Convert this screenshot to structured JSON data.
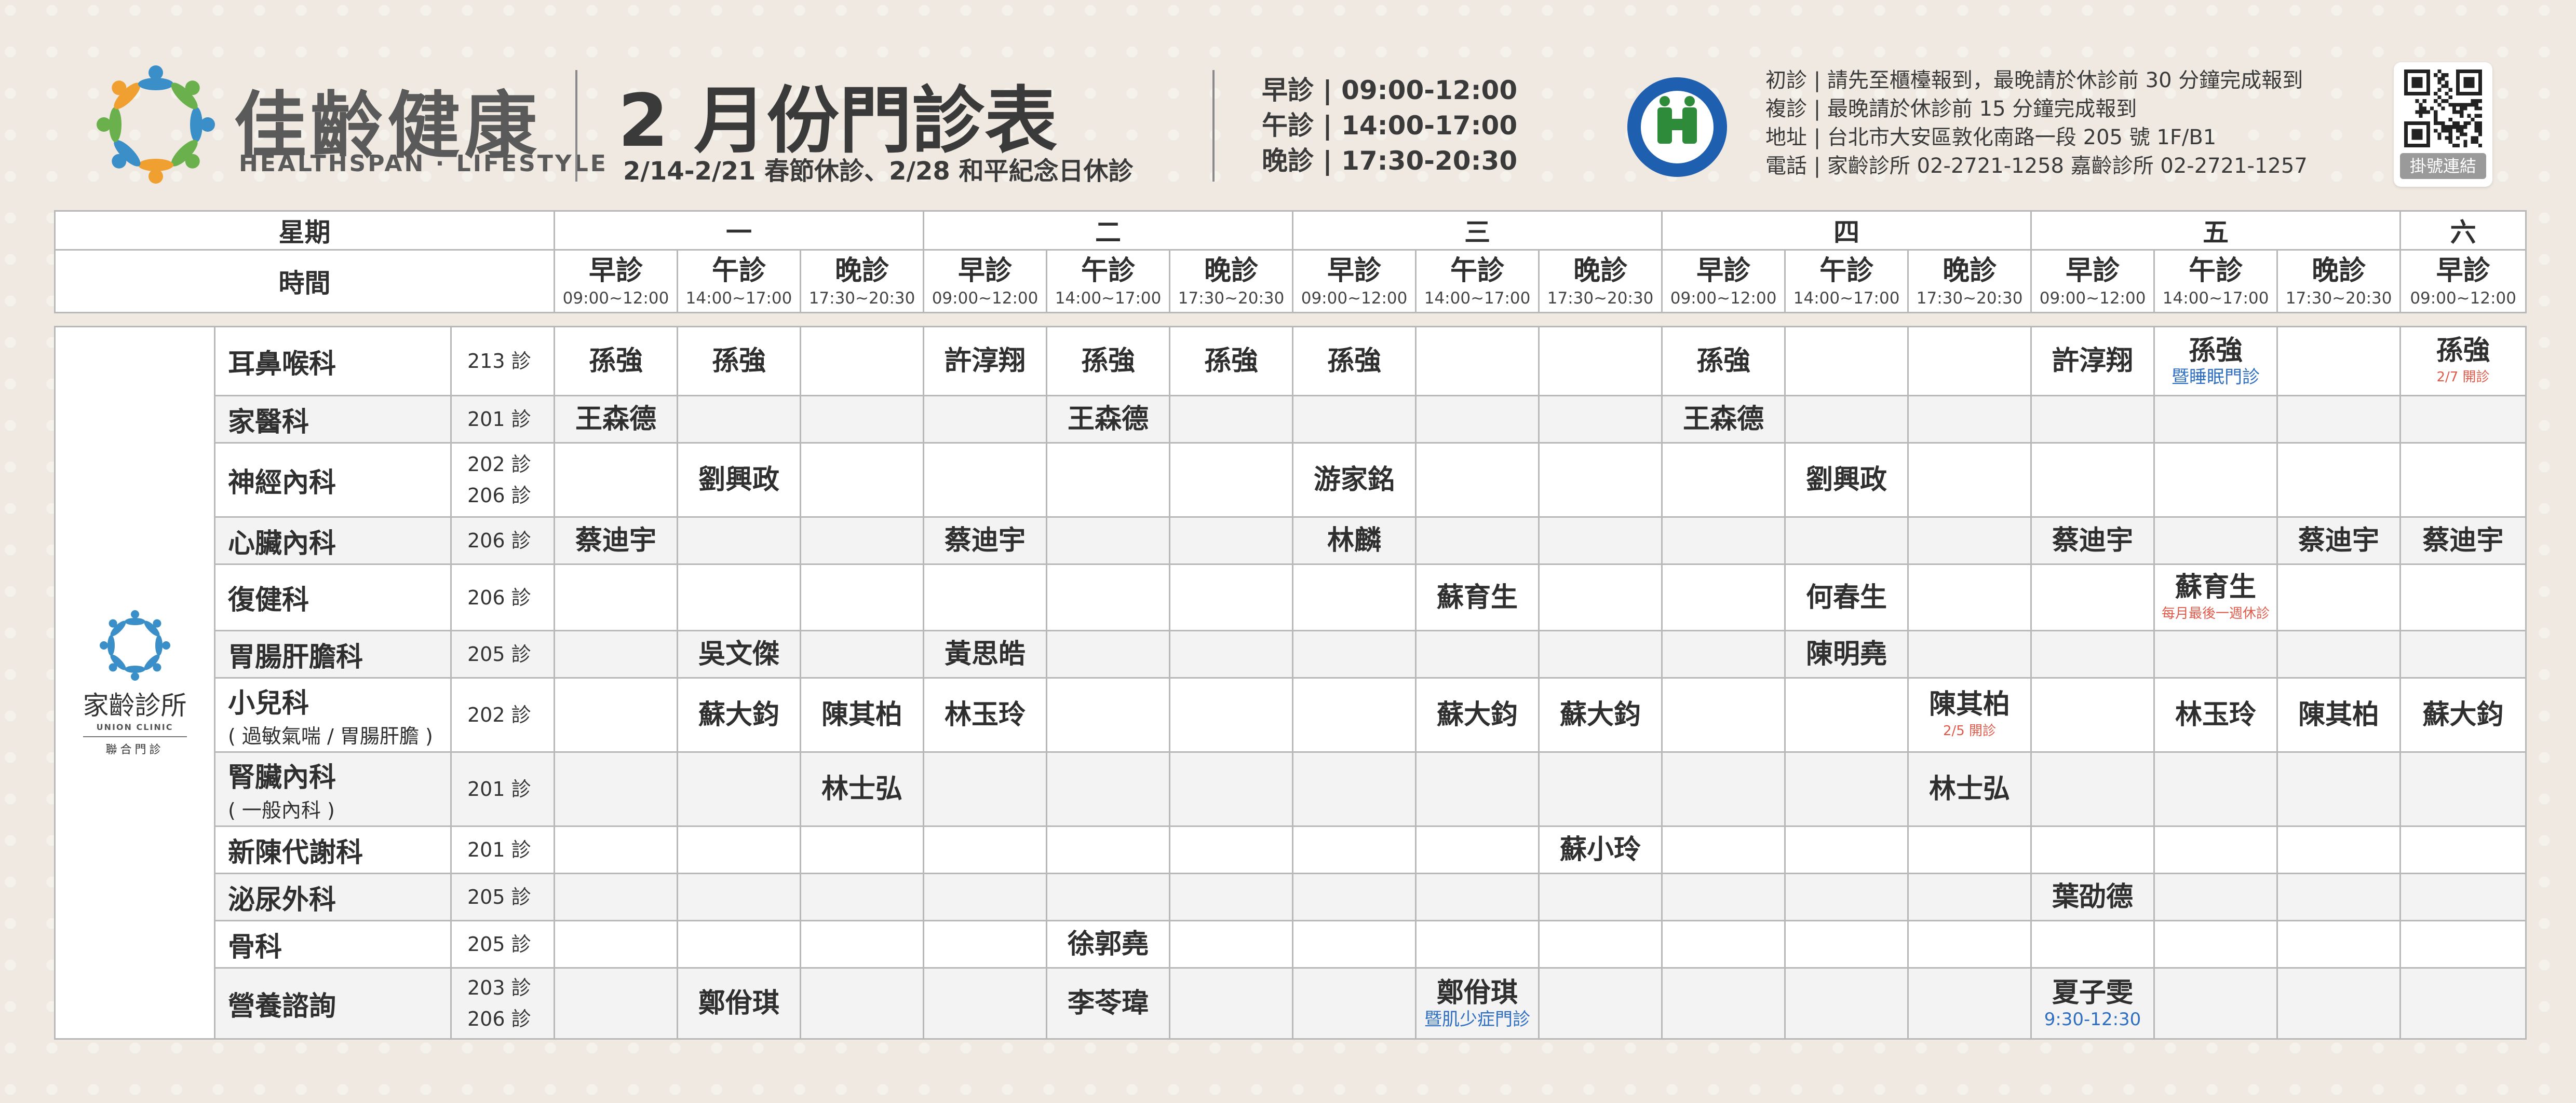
{
  "header": {
    "brand_name": "佳齡健康",
    "brand_sub": "HEALTHSPAN · LIFESTYLE",
    "title": "2 月份門診表",
    "subtitle": "2/14-2/21 春節休診、2/28 和平紀念日休診",
    "sessions": [
      {
        "label": "早診",
        "time": "09:00-12:00"
      },
      {
        "label": "午診",
        "time": "14:00-17:00"
      },
      {
        "label": "晚診",
        "time": "17:30-20:30"
      }
    ],
    "nhi_text": "全民健康保險 NATIONAL HEALTH INSURANCE",
    "notes": [
      {
        "label": "初診",
        "text": "請先至櫃檯報到，最晚請於休診前 30 分鐘完成報到"
      },
      {
        "label": "複診",
        "text": "最晚請於休診前 15 分鐘完成報到"
      },
      {
        "label": "地址",
        "text": "台北市大安區敦化南路一段 205 號 1F/B1"
      },
      {
        "label": "電話",
        "text": "家齡診所 02-2721-1258 嘉齡診所 02-2721-1257"
      }
    ],
    "qr_label": "掛號連結"
  },
  "table": {
    "weekday_label": "星期",
    "time_label": "時間",
    "days": [
      "一",
      "二",
      "三",
      "四",
      "五",
      "六"
    ],
    "session_names": [
      "早診",
      "午診",
      "晚診"
    ],
    "session_times": [
      "09:00~12:00",
      "14:00~17:00",
      "17:30~20:30"
    ],
    "clinic": {
      "name": "家齡診所",
      "en": "UNION CLINIC",
      "tag": "聯合門診"
    },
    "rows": [
      {
        "dept": "耳鼻喉科",
        "dept_sub": "",
        "room": "213 診",
        "cells": [
          {
            "doctor": "孫強"
          },
          {
            "doctor": "孫強"
          },
          {},
          {
            "doctor": "許淳翔"
          },
          {
            "doctor": "孫強"
          },
          {
            "doctor": "孫強"
          },
          {
            "doctor": "孫強"
          },
          {},
          {},
          {
            "doctor": "孫強"
          },
          {},
          {},
          {
            "doctor": "許淳翔"
          },
          {
            "doctor": "孫強",
            "note": "暨睡眠門診",
            "note_color": "blue"
          },
          {},
          {
            "doctor": "孫強",
            "note": "2/7 開診",
            "note_color": "red"
          }
        ]
      },
      {
        "dept": "家醫科",
        "dept_sub": "",
        "room": "201 診",
        "cells": [
          {
            "doctor": "王森德"
          },
          {},
          {},
          {},
          {
            "doctor": "王森德"
          },
          {},
          {},
          {},
          {},
          {
            "doctor": "王森德"
          },
          {},
          {},
          {},
          {},
          {},
          {}
        ]
      },
      {
        "dept": "神經內科",
        "dept_sub": "",
        "room": "202 診\n206 診",
        "cells": [
          {},
          {
            "doctor": "劉興政"
          },
          {},
          {},
          {},
          {},
          {
            "doctor": "游家銘"
          },
          {},
          {},
          {},
          {
            "doctor": "劉興政"
          },
          {},
          {},
          {},
          {},
          {}
        ]
      },
      {
        "dept": "心臟內科",
        "dept_sub": "",
        "room": "206 診",
        "cells": [
          {
            "doctor": "蔡迪宇"
          },
          {},
          {},
          {
            "doctor": "蔡迪宇"
          },
          {},
          {},
          {
            "doctor": "林麟"
          },
          {},
          {},
          {},
          {},
          {},
          {
            "doctor": "蔡迪宇"
          },
          {},
          {
            "doctor": "蔡迪宇"
          },
          {
            "doctor": "蔡迪宇"
          }
        ]
      },
      {
        "dept": "復健科",
        "dept_sub": "",
        "room": "206 診",
        "cells": [
          {},
          {},
          {},
          {},
          {},
          {},
          {},
          {
            "doctor": "蘇育生"
          },
          {},
          {},
          {
            "doctor": "何春生"
          },
          {},
          {},
          {
            "doctor": "蘇育生",
            "note": "每月最後一週休診",
            "note_color": "red"
          },
          {},
          {}
        ]
      },
      {
        "dept": "胃腸肝膽科",
        "dept_sub": "",
        "room": "205 診",
        "cells": [
          {},
          {
            "doctor": "吳文傑"
          },
          {},
          {
            "doctor": "黃思皓"
          },
          {},
          {},
          {},
          {},
          {},
          {},
          {
            "doctor": "陳明堯"
          },
          {},
          {},
          {},
          {},
          {}
        ]
      },
      {
        "dept": "小兒科",
        "dept_sub": "( 過敏氣喘 / 胃腸肝膽 )",
        "room": "202 診",
        "cells": [
          {},
          {
            "doctor": "蘇大鈞"
          },
          {
            "doctor": "陳其柏"
          },
          {
            "doctor": "林玉玲"
          },
          {},
          {},
          {},
          {
            "doctor": "蘇大鈞"
          },
          {
            "doctor": "蘇大鈞"
          },
          {},
          {},
          {
            "doctor": "陳其柏",
            "note": "2/5 開診",
            "note_color": "red"
          },
          {},
          {
            "doctor": "林玉玲"
          },
          {
            "doctor": "陳其柏"
          },
          {
            "doctor": "蘇大鈞"
          }
        ]
      },
      {
        "dept": "腎臟內科",
        "dept_sub": "( 一般內科 )",
        "room": "201 診",
        "cells": [
          {},
          {},
          {
            "doctor": "林士弘"
          },
          {},
          {},
          {},
          {},
          {},
          {},
          {},
          {},
          {
            "doctor": "林士弘"
          },
          {},
          {},
          {},
          {}
        ]
      },
      {
        "dept": "新陳代謝科",
        "dept_sub": "",
        "room": "201 診",
        "cells": [
          {},
          {},
          {},
          {},
          {},
          {},
          {},
          {},
          {
            "doctor": "蘇小玲"
          },
          {},
          {},
          {},
          {},
          {},
          {},
          {}
        ]
      },
      {
        "dept": "泌尿外科",
        "dept_sub": "",
        "room": "205 診",
        "cells": [
          {},
          {},
          {},
          {},
          {},
          {},
          {},
          {},
          {},
          {},
          {},
          {},
          {
            "doctor": "葉劭德"
          },
          {},
          {},
          {}
        ]
      },
      {
        "dept": "骨科",
        "dept_sub": "",
        "room": "205 診",
        "cells": [
          {},
          {},
          {},
          {},
          {
            "doctor": "徐郭堯"
          },
          {},
          {},
          {},
          {},
          {},
          {},
          {},
          {},
          {},
          {},
          {}
        ]
      },
      {
        "dept": "營養諮詢",
        "dept_sub": "",
        "room": "203 診\n206 診",
        "cells": [
          {},
          {
            "doctor": "鄭佾琪"
          },
          {},
          {},
          {
            "doctor": "李苓瑋"
          },
          {},
          {},
          {
            "doctor": "鄭佾琪",
            "note": "暨肌少症門診",
            "note_color": "blue"
          },
          {},
          {},
          {},
          {},
          {
            "doctor": "夏子雯",
            "note": "9:30-12:30",
            "note_color": "blue"
          },
          {},
          {},
          {}
        ]
      }
    ]
  },
  "colors": {
    "background": "#efe9e1",
    "border": "#b8b8b8",
    "note_blue": "#2e6fc2",
    "note_red": "#e05a4a",
    "logo_blue": "#3a8fc8",
    "logo_green": "#6ab04c",
    "logo_orange": "#f0a030",
    "nhi_green": "#2e8b3a",
    "nhi_blue": "#1f5fb0"
  },
  "icons": {
    "logo": "people-circle-logo",
    "nhi": "national-health-insurance-seal",
    "qr": "qr-code",
    "clinic": "people-circle-logo"
  }
}
